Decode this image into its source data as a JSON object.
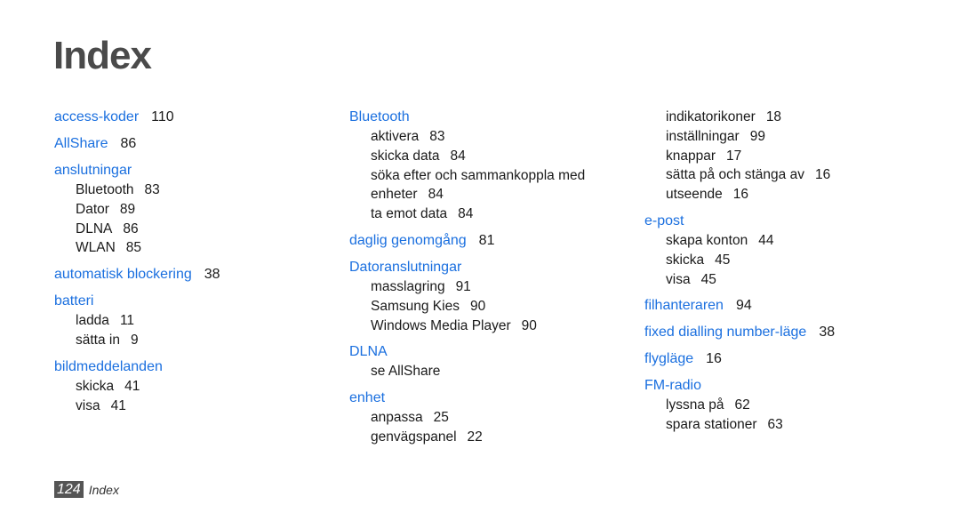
{
  "title": "Index",
  "columns": [
    [
      {
        "term": "access-koder",
        "page": "110",
        "subs": []
      },
      {
        "term": "AllShare",
        "page": "86",
        "subs": []
      },
      {
        "term": "anslutningar",
        "page": "",
        "subs": [
          {
            "term": "Bluetooth",
            "page": "83"
          },
          {
            "term": "Dator",
            "page": "89"
          },
          {
            "term": "DLNA",
            "page": "86"
          },
          {
            "term": "WLAN",
            "page": "85"
          }
        ]
      },
      {
        "term": "automatisk blockering",
        "page": "38",
        "subs": []
      },
      {
        "term": "batteri",
        "page": "",
        "subs": [
          {
            "term": "ladda",
            "page": "11"
          },
          {
            "term": "sätta in",
            "page": "9"
          }
        ]
      },
      {
        "term": "bildmeddelanden",
        "page": "",
        "subs": [
          {
            "term": "skicka",
            "page": "41"
          },
          {
            "term": "visa",
            "page": "41"
          }
        ]
      }
    ],
    [
      {
        "term": "Bluetooth",
        "page": "",
        "subs": [
          {
            "term": "aktivera",
            "page": "83"
          },
          {
            "term": "skicka data",
            "page": "84"
          },
          {
            "term": "söka efter och sammankoppla med",
            "page": ""
          },
          {
            "term": "enheter",
            "page": "84"
          },
          {
            "term": "ta emot data",
            "page": "84"
          }
        ]
      },
      {
        "term": "daglig genomgång",
        "page": "81",
        "subs": []
      },
      {
        "term": "Datoranslutningar",
        "page": "",
        "subs": [
          {
            "term": "masslagring",
            "page": "91"
          },
          {
            "term": "Samsung Kies",
            "page": "90"
          },
          {
            "term": "Windows Media Player",
            "page": "90"
          }
        ]
      },
      {
        "term": "DLNA",
        "page": "",
        "subs": [
          {
            "term": "se AllShare",
            "page": ""
          }
        ]
      },
      {
        "term": "enhet",
        "page": "",
        "subs": [
          {
            "term": "anpassa",
            "page": "25"
          },
          {
            "term": "genvägspanel",
            "page": "22"
          }
        ]
      }
    ],
    [
      {
        "term": "",
        "page": "",
        "subs": [
          {
            "term": "indikatorikoner",
            "page": "18"
          },
          {
            "term": "inställningar",
            "page": "99"
          },
          {
            "term": "knappar",
            "page": "17"
          },
          {
            "term": "sätta på och stänga av",
            "page": "16"
          },
          {
            "term": "utseende",
            "page": "16"
          }
        ]
      },
      {
        "term": "e-post",
        "page": "",
        "subs": [
          {
            "term": "skapa konton",
            "page": "44"
          },
          {
            "term": "skicka",
            "page": "45"
          },
          {
            "term": "visa",
            "page": "45"
          }
        ]
      },
      {
        "term": "filhanteraren",
        "page": "94",
        "subs": []
      },
      {
        "term": "fixed dialling number-läge",
        "page": "38",
        "subs": []
      },
      {
        "term": "flygläge",
        "page": "16",
        "subs": []
      },
      {
        "term": "FM-radio",
        "page": "",
        "subs": [
          {
            "term": "lyssna på",
            "page": "62"
          },
          {
            "term": "spara stationer",
            "page": "63"
          }
        ]
      }
    ]
  ],
  "footer": {
    "page_number": "124",
    "label": "Index"
  }
}
